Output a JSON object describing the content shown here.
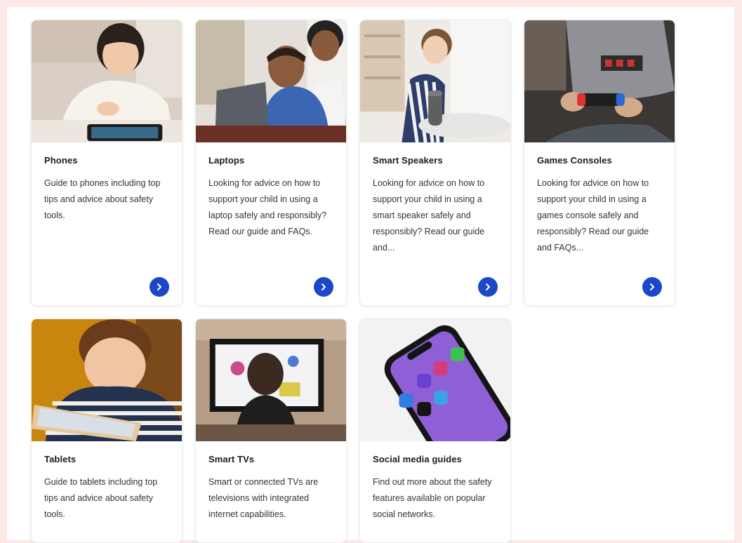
{
  "colors": {
    "accent": "#1a48c8",
    "page_background": "#fde8e8"
  },
  "cards": [
    {
      "title": "Phones",
      "description": "Guide to phones including top tips and advice about safety tools.",
      "image": "child-using-phone-image",
      "has_arrow": true
    },
    {
      "title": "Laptops",
      "description": "Looking for advice on how to support your child in using a laptop safely and responsibly? Read our guide and FAQs.",
      "image": "children-using-laptop-image",
      "has_arrow": true
    },
    {
      "title": "Smart Speakers",
      "description": "Looking for advice on how to support your child in using a smart speaker safely and responsibly? Read our guide and...",
      "image": "child-with-smart-speaker-image",
      "has_arrow": true
    },
    {
      "title": "Games Consoles",
      "description": "Looking for advice on how to support your child in using a games console safely and responsibly? Read our guide and FAQs...",
      "image": "child-with-game-controller-image",
      "has_arrow": true
    },
    {
      "title": "Tablets",
      "description": "Guide to tablets including top tips and advice about safety tools.",
      "image": "child-using-tablet-image",
      "has_arrow": false
    },
    {
      "title": "Smart TVs",
      "description": "Smart or connected TVs are televisions with integrated internet capabilities.",
      "image": "child-watching-tv-image",
      "has_arrow": false
    },
    {
      "title": "Social media guides",
      "description": "Find out more about the safety features available on popular social networks.",
      "image": "phone-social-apps-image",
      "has_arrow": false
    }
  ]
}
